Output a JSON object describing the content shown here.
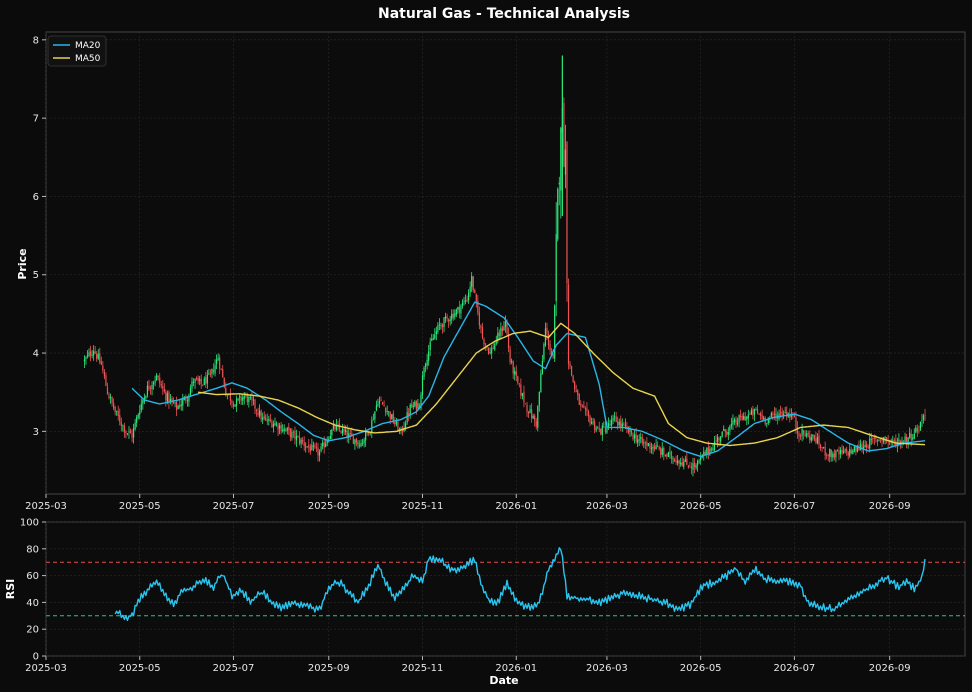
{
  "chart_data": {
    "type": "candlestick",
    "title": "Natural Gas - Technical Analysis",
    "colors": {
      "background": "#0b0b0b",
      "up": "#2ee87a",
      "down": "#f05454",
      "ma20": "#29b6e8",
      "ma50": "#e8d44d",
      "rsi": "#29c5f0",
      "overbought": "#e64a4a",
      "oversold": "#22c78a",
      "grid": "#2a2a2a",
      "spine": "#444444"
    },
    "price_panel": {
      "ylabel": "Price",
      "ylim": [
        2.2,
        8.1
      ],
      "yticks": [
        "3",
        "4",
        "5",
        "6",
        "7",
        "8"
      ],
      "grid": true,
      "legend_position": "top-left",
      "legend": [
        {
          "name": "MA20",
          "color": "#29b6e8"
        },
        {
          "name": "MA50",
          "color": "#e8d44d"
        }
      ]
    },
    "rsi_panel": {
      "ylabel": "RSI",
      "ylim": [
        0,
        100
      ],
      "yticks": [
        "0",
        "20",
        "40",
        "60",
        "80",
        "100"
      ],
      "overbought": 70,
      "oversold": 30
    },
    "xlabel": "Date",
    "xlim": [
      "2025-03-01",
      "2026-10-20"
    ],
    "xticks": [
      "2025-03",
      "2025-05",
      "2025-07",
      "2025-09",
      "2025-11",
      "2026-01",
      "2026-03",
      "2026-05",
      "2026-07",
      "2026-09"
    ],
    "price_anchors": [
      [
        "2025-03-26",
        3.9
      ],
      [
        "2025-04-01",
        4.05
      ],
      [
        "2025-04-06",
        3.85
      ],
      [
        "2025-04-10",
        3.5
      ],
      [
        "2025-04-15",
        3.25
      ],
      [
        "2025-04-22",
        3.0
      ],
      [
        "2025-04-26",
        2.95
      ],
      [
        "2025-05-01",
        3.3
      ],
      [
        "2025-05-06",
        3.55
      ],
      [
        "2025-05-12",
        3.7
      ],
      [
        "2025-05-18",
        3.45
      ],
      [
        "2025-05-25",
        3.3
      ],
      [
        "2025-06-01",
        3.45
      ],
      [
        "2025-06-05",
        3.65
      ],
      [
        "2025-06-10",
        3.6
      ],
      [
        "2025-06-16",
        3.7
      ],
      [
        "2025-06-21",
        3.95
      ],
      [
        "2025-06-26",
        3.5
      ],
      [
        "2025-07-02",
        3.35
      ],
      [
        "2025-07-08",
        3.45
      ],
      [
        "2025-07-14",
        3.35
      ],
      [
        "2025-07-20",
        3.15
      ],
      [
        "2025-07-28",
        3.1
      ],
      [
        "2025-08-05",
        3.0
      ],
      [
        "2025-08-12",
        2.9
      ],
      [
        "2025-08-20",
        2.78
      ],
      [
        "2025-08-26",
        2.72
      ],
      [
        "2025-09-01",
        2.95
      ],
      [
        "2025-09-05",
        3.05
      ],
      [
        "2025-09-10",
        3.0
      ],
      [
        "2025-09-15",
        2.92
      ],
      [
        "2025-09-22",
        2.85
      ],
      [
        "2025-09-28",
        3.05
      ],
      [
        "2025-10-03",
        3.4
      ],
      [
        "2025-10-08",
        3.3
      ],
      [
        "2025-10-14",
        3.1
      ],
      [
        "2025-10-18",
        2.98
      ],
      [
        "2025-10-24",
        3.3
      ],
      [
        "2025-10-30",
        3.35
      ],
      [
        "2025-11-02",
        3.85
      ],
      [
        "2025-11-07",
        4.15
      ],
      [
        "2025-11-12",
        4.35
      ],
      [
        "2025-11-18",
        4.45
      ],
      [
        "2025-11-24",
        4.55
      ],
      [
        "2025-11-30",
        4.7
      ],
      [
        "2025-12-03",
        4.95
      ],
      [
        "2025-12-06",
        4.6
      ],
      [
        "2025-12-10",
        4.2
      ],
      [
        "2025-12-15",
        4.0
      ],
      [
        "2025-12-20",
        4.2
      ],
      [
        "2025-12-25",
        4.4
      ],
      [
        "2025-12-28",
        3.9
      ],
      [
        "2026-01-02",
        3.6
      ],
      [
        "2026-01-08",
        3.3
      ],
      [
        "2026-01-14",
        3.1
      ],
      [
        "2026-01-20",
        4.3
      ],
      [
        "2026-01-25",
        3.9
      ],
      [
        "2026-01-28",
        5.9
      ],
      [
        "2026-01-30",
        7.1
      ],
      [
        "2026-02-02",
        6.5
      ],
      [
        "2026-02-04",
        3.9
      ],
      [
        "2026-02-08",
        3.55
      ],
      [
        "2026-02-12",
        3.3
      ],
      [
        "2026-02-18",
        3.15
      ],
      [
        "2026-02-24",
        3.0
      ],
      [
        "2026-03-01",
        3.05
      ],
      [
        "2026-03-06",
        3.15
      ],
      [
        "2026-03-12",
        3.05
      ],
      [
        "2026-03-18",
        2.95
      ],
      [
        "2026-03-24",
        2.85
      ],
      [
        "2026-04-01",
        2.8
      ],
      [
        "2026-04-08",
        2.7
      ],
      [
        "2026-04-15",
        2.65
      ],
      [
        "2026-04-22",
        2.58
      ],
      [
        "2026-04-28",
        2.55
      ],
      [
        "2026-05-03",
        2.7
      ],
      [
        "2026-05-08",
        2.8
      ],
      [
        "2026-05-14",
        2.95
      ],
      [
        "2026-05-20",
        3.05
      ],
      [
        "2026-05-26",
        3.15
      ],
      [
        "2026-06-01",
        3.2
      ],
      [
        "2026-06-06",
        3.25
      ],
      [
        "2026-06-12",
        3.15
      ],
      [
        "2026-06-18",
        3.2
      ],
      [
        "2026-06-24",
        3.25
      ],
      [
        "2026-06-30",
        3.2
      ],
      [
        "2026-07-03",
        3.0
      ],
      [
        "2026-07-09",
        2.95
      ],
      [
        "2026-07-15",
        2.9
      ],
      [
        "2026-07-20",
        2.75
      ],
      [
        "2026-07-26",
        2.7
      ],
      [
        "2026-08-01",
        2.72
      ],
      [
        "2026-08-08",
        2.75
      ],
      [
        "2026-08-15",
        2.82
      ],
      [
        "2026-08-22",
        2.88
      ],
      [
        "2026-08-28",
        2.92
      ],
      [
        "2026-09-03",
        2.85
      ],
      [
        "2026-09-09",
        2.88
      ],
      [
        "2026-09-15",
        2.95
      ],
      [
        "2026-09-20",
        3.05
      ],
      [
        "2026-09-24",
        3.25
      ]
    ],
    "ma20": [
      [
        "2025-04-26",
        3.55
      ],
      [
        "2025-05-04",
        3.4
      ],
      [
        "2025-05-14",
        3.35
      ],
      [
        "2025-05-26",
        3.4
      ],
      [
        "2025-06-08",
        3.48
      ],
      [
        "2025-06-20",
        3.55
      ],
      [
        "2025-06-30",
        3.62
      ],
      [
        "2025-07-10",
        3.55
      ],
      [
        "2025-07-22",
        3.4
      ],
      [
        "2025-08-01",
        3.25
      ],
      [
        "2025-08-12",
        3.1
      ],
      [
        "2025-08-22",
        2.95
      ],
      [
        "2025-09-01",
        2.88
      ],
      [
        "2025-09-12",
        2.92
      ],
      [
        "2025-09-24",
        3.0
      ],
      [
        "2025-10-06",
        3.1
      ],
      [
        "2025-10-18",
        3.15
      ],
      [
        "2025-10-28",
        3.25
      ],
      [
        "2025-11-05",
        3.45
      ],
      [
        "2025-11-15",
        3.95
      ],
      [
        "2025-11-25",
        4.3
      ],
      [
        "2025-12-05",
        4.65
      ],
      [
        "2025-12-12",
        4.6
      ],
      [
        "2025-12-24",
        4.45
      ],
      [
        "2026-01-02",
        4.2
      ],
      [
        "2026-01-12",
        3.9
      ],
      [
        "2026-01-20",
        3.8
      ],
      [
        "2026-01-27",
        4.1
      ],
      [
        "2026-02-03",
        4.25
      ],
      [
        "2026-02-15",
        4.2
      ],
      [
        "2026-02-24",
        3.6
      ],
      [
        "2026-03-01",
        3.05
      ],
      [
        "2026-03-12",
        3.05
      ],
      [
        "2026-03-24",
        3.0
      ],
      [
        "2026-04-05",
        2.9
      ],
      [
        "2026-04-20",
        2.75
      ],
      [
        "2026-05-01",
        2.68
      ],
      [
        "2026-05-12",
        2.75
      ],
      [
        "2026-05-24",
        2.92
      ],
      [
        "2026-06-05",
        3.1
      ],
      [
        "2026-06-18",
        3.18
      ],
      [
        "2026-07-01",
        3.22
      ],
      [
        "2026-07-12",
        3.15
      ],
      [
        "2026-07-24",
        3.0
      ],
      [
        "2026-08-05",
        2.85
      ],
      [
        "2026-08-18",
        2.75
      ],
      [
        "2026-08-30",
        2.78
      ],
      [
        "2026-09-10",
        2.85
      ],
      [
        "2026-09-24",
        2.88
      ]
    ],
    "ma50": [
      [
        "2025-06-08",
        3.5
      ],
      [
        "2025-06-20",
        3.47
      ],
      [
        "2025-07-05",
        3.48
      ],
      [
        "2025-07-18",
        3.45
      ],
      [
        "2025-07-30",
        3.4
      ],
      [
        "2025-08-12",
        3.3
      ],
      [
        "2025-08-24",
        3.18
      ],
      [
        "2025-09-05",
        3.08
      ],
      [
        "2025-09-18",
        3.02
      ],
      [
        "2025-10-01",
        2.98
      ],
      [
        "2025-10-15",
        3.0
      ],
      [
        "2025-10-28",
        3.08
      ],
      [
        "2025-11-10",
        3.35
      ],
      [
        "2025-11-24",
        3.7
      ],
      [
        "2025-12-06",
        4.0
      ],
      [
        "2025-12-18",
        4.15
      ],
      [
        "2025-12-30",
        4.25
      ],
      [
        "2026-01-10",
        4.28
      ],
      [
        "2026-01-22",
        4.2
      ],
      [
        "2026-01-30",
        4.38
      ],
      [
        "2026-02-08",
        4.25
      ],
      [
        "2026-02-20",
        4.0
      ],
      [
        "2026-03-05",
        3.75
      ],
      [
        "2026-03-18",
        3.55
      ],
      [
        "2026-04-01",
        3.45
      ],
      [
        "2026-04-10",
        3.1
      ],
      [
        "2026-04-22",
        2.92
      ],
      [
        "2026-05-05",
        2.85
      ],
      [
        "2026-05-20",
        2.82
      ],
      [
        "2026-06-05",
        2.85
      ],
      [
        "2026-06-20",
        2.92
      ],
      [
        "2026-07-05",
        3.05
      ],
      [
        "2026-07-20",
        3.08
      ],
      [
        "2026-08-05",
        3.05
      ],
      [
        "2026-08-20",
        2.95
      ],
      [
        "2026-09-05",
        2.85
      ],
      [
        "2026-09-24",
        2.83
      ]
    ],
    "rsi": [
      [
        "2025-04-15",
        33
      ],
      [
        "2025-04-22",
        29
      ],
      [
        "2025-04-26",
        30
      ],
      [
        "2025-05-02",
        45
      ],
      [
        "2025-05-07",
        50
      ],
      [
        "2025-05-12",
        55
      ],
      [
        "2025-05-18",
        45
      ],
      [
        "2025-05-23",
        38
      ],
      [
        "2025-05-28",
        48
      ],
      [
        "2025-06-05",
        52
      ],
      [
        "2025-06-12",
        57
      ],
      [
        "2025-06-18",
        52
      ],
      [
        "2025-06-24",
        62
      ],
      [
        "2025-06-30",
        45
      ],
      [
        "2025-07-06",
        50
      ],
      [
        "2025-07-12",
        40
      ],
      [
        "2025-07-20",
        48
      ],
      [
        "2025-07-26",
        40
      ],
      [
        "2025-08-02",
        36
      ],
      [
        "2025-08-10",
        40
      ],
      [
        "2025-08-18",
        37
      ],
      [
        "2025-08-26",
        35
      ],
      [
        "2025-09-01",
        52
      ],
      [
        "2025-09-08",
        55
      ],
      [
        "2025-09-14",
        47
      ],
      [
        "2025-09-20",
        40
      ],
      [
        "2025-09-28",
        55
      ],
      [
        "2025-10-03",
        68
      ],
      [
        "2025-10-08",
        55
      ],
      [
        "2025-10-14",
        43
      ],
      [
        "2025-10-20",
        50
      ],
      [
        "2025-10-26",
        60
      ],
      [
        "2025-11-01",
        55
      ],
      [
        "2025-11-05",
        72
      ],
      [
        "2025-11-12",
        72
      ],
      [
        "2025-11-18",
        66
      ],
      [
        "2025-11-24",
        63
      ],
      [
        "2025-11-30",
        68
      ],
      [
        "2025-12-05",
        73
      ],
      [
        "2025-12-09",
        55
      ],
      [
        "2025-12-14",
        42
      ],
      [
        "2025-12-20",
        40
      ],
      [
        "2025-12-26",
        55
      ],
      [
        "2025-12-30",
        45
      ],
      [
        "2026-01-04",
        38
      ],
      [
        "2026-01-10",
        37
      ],
      [
        "2026-01-16",
        40
      ],
      [
        "2026-01-22",
        65
      ],
      [
        "2026-01-30",
        82
      ],
      [
        "2026-02-03",
        45
      ],
      [
        "2026-02-10",
        43
      ],
      [
        "2026-02-18",
        42
      ],
      [
        "2026-02-26",
        40
      ],
      [
        "2026-03-06",
        45
      ],
      [
        "2026-03-14",
        47
      ],
      [
        "2026-03-22",
        45
      ],
      [
        "2026-03-30",
        42
      ],
      [
        "2026-04-08",
        40
      ],
      [
        "2026-04-16",
        35
      ],
      [
        "2026-04-24",
        38
      ],
      [
        "2026-05-02",
        52
      ],
      [
        "2026-05-10",
        55
      ],
      [
        "2026-05-18",
        60
      ],
      [
        "2026-05-24",
        65
      ],
      [
        "2026-05-30",
        55
      ],
      [
        "2026-06-05",
        65
      ],
      [
        "2026-06-12",
        58
      ],
      [
        "2026-06-20",
        55
      ],
      [
        "2026-06-28",
        56
      ],
      [
        "2026-07-05",
        52
      ],
      [
        "2026-07-10",
        40
      ],
      [
        "2026-07-18",
        37
      ],
      [
        "2026-07-26",
        35
      ],
      [
        "2026-08-02",
        40
      ],
      [
        "2026-08-10",
        45
      ],
      [
        "2026-08-18",
        50
      ],
      [
        "2026-08-24",
        55
      ],
      [
        "2026-08-30",
        58
      ],
      [
        "2026-09-06",
        52
      ],
      [
        "2026-09-12",
        55
      ],
      [
        "2026-09-18",
        50
      ],
      [
        "2026-09-22",
        60
      ],
      [
        "2026-09-24",
        72
      ]
    ]
  }
}
